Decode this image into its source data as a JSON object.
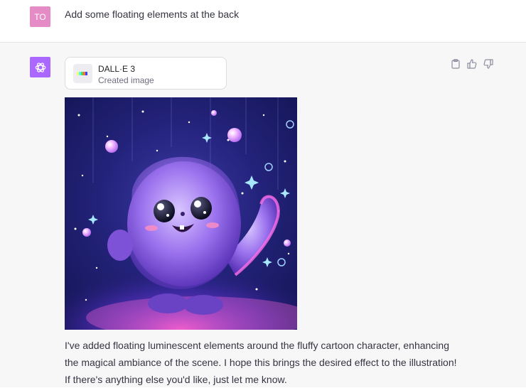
{
  "user": {
    "avatar_initials": "TO",
    "avatar_color": "#e58cc6",
    "message": "Add some floating elements at the back"
  },
  "assistant": {
    "avatar_icon": "openai-logo-icon",
    "avatar_color": "#ab68ff",
    "tool": {
      "name": "DALL·E 3",
      "status": "Created image",
      "icon": "dalle-color-bar-icon"
    },
    "actions": [
      {
        "name": "copy",
        "icon": "clipboard-icon"
      },
      {
        "name": "thumbs-up",
        "icon": "thumbs-up-icon"
      },
      {
        "name": "thumbs-down",
        "icon": "thumbs-down-icon"
      }
    ],
    "reply": "I've added floating luminescent elements around the fluffy cartoon character, enhancing the magical ambiance of the scene. I hope this brings the desired effect to the illustration! If there's anything else you'd like, just let me know."
  },
  "colors": {
    "assistant_bg": "#f7f7f8",
    "text": "#343541",
    "muted": "#6e6e80"
  }
}
